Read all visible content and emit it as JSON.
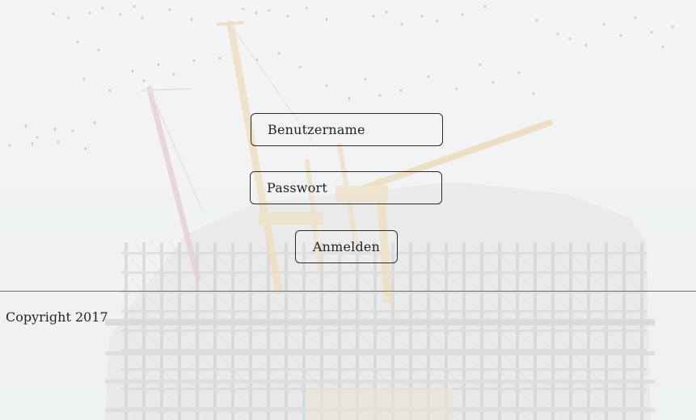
{
  "login": {
    "username_placeholder": "Benutzername",
    "password_placeholder": "Passwort",
    "submit_label": "Anmelden"
  },
  "footer": {
    "copyright": "Copyright 2017"
  },
  "colors": {
    "page_background": "#f1f3f4",
    "text": "#222222",
    "border": "#2b2b2b",
    "divider": "#6f6f6f"
  }
}
